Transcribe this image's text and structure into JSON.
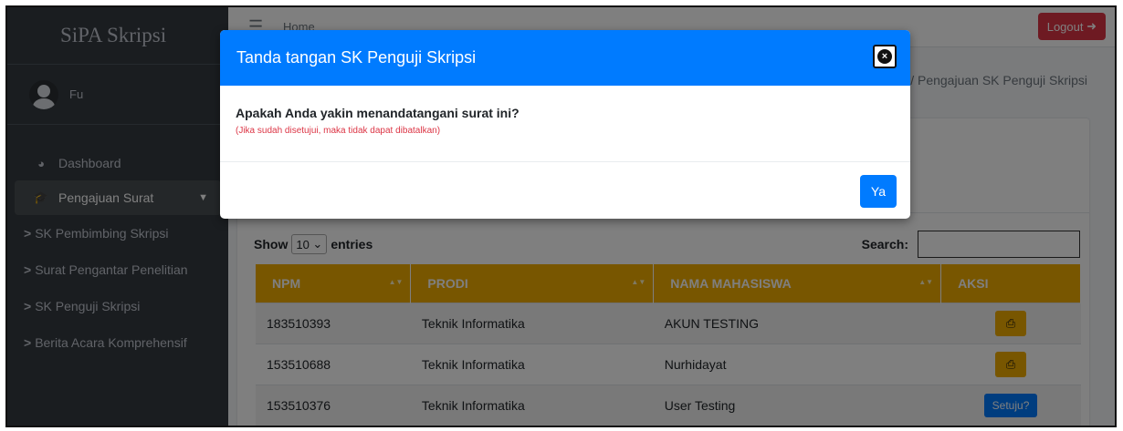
{
  "brand": "SiPA Skripsi",
  "user": {
    "name": "Fu"
  },
  "nav": {
    "dashboard": "Dashboard",
    "pengajuan": "Pengajuan Surat",
    "sub_items": [
      "SK Pembimbing Skripsi",
      "Surat Pengantar Penelitian",
      "SK Penguji Skripsi",
      "Berita Acara Komprehensif"
    ]
  },
  "topbar": {
    "home": "Home",
    "logout": "Logout"
  },
  "breadcrumb": "/  Pengajuan SK Penguji Skripsi",
  "table_controls": {
    "show": "Show",
    "entries_value": "10",
    "entries": "entries",
    "search": "Search:"
  },
  "table": {
    "columns": [
      "NPM",
      "PRODI",
      "NAMA MAHASISWA",
      "AKSI"
    ],
    "rows": [
      {
        "npm": "183510393",
        "prodi": "Teknik Informatika",
        "nama": "AKUN TESTING",
        "aksi": "print"
      },
      {
        "npm": "153510688",
        "prodi": "Teknik Informatika",
        "nama": "Nurhidayat",
        "aksi": "print"
      },
      {
        "npm": "153510376",
        "prodi": "Teknik Informatika",
        "nama": "User Testing",
        "aksi": "Setuju?"
      }
    ]
  },
  "modal": {
    "title": "Tanda tangan SK Penguji Skripsi",
    "question": "Apakah Anda yakin menandatangani surat ini?",
    "note": "(Jika sudah disetujui, maka tidak dapat dibatalkan)",
    "confirm": "Ya"
  },
  "colors": {
    "primary": "#007bff",
    "warning": "#f0ad00",
    "danger": "#dc3545",
    "sidebar": "#343a40"
  }
}
